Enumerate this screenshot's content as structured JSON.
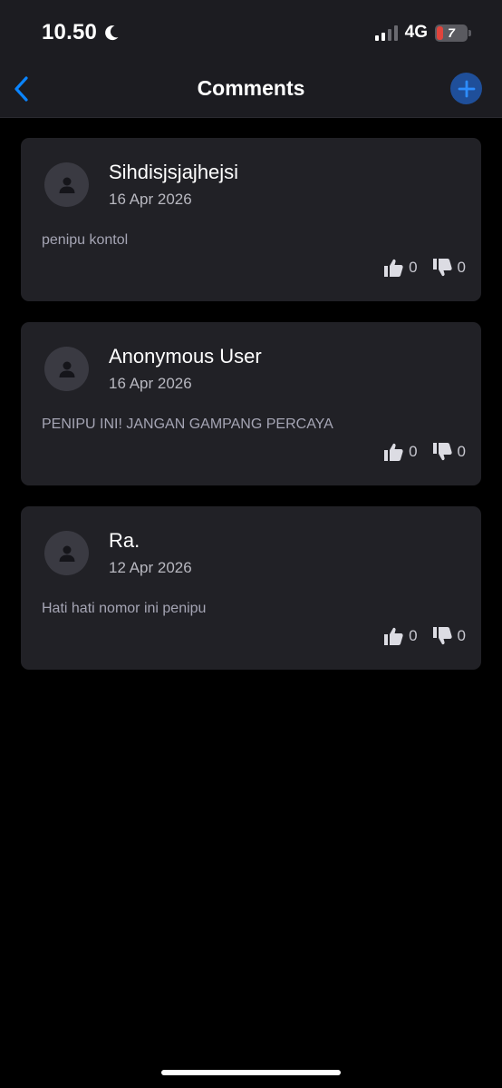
{
  "status_bar": {
    "time": "10.50",
    "network": "4G",
    "battery": "7"
  },
  "header": {
    "title": "Comments"
  },
  "comments": [
    {
      "author": "Sihdisjsjajhejsi",
      "date": "16 Apr 2026",
      "text": "penipu kontol",
      "likes": "0",
      "dislikes": "0"
    },
    {
      "author": "Anonymous User",
      "date": "16 Apr 2026",
      "text": "PENIPU INI! JANGAN GAMPANG PERCAYA",
      "likes": "0",
      "dislikes": "0"
    },
    {
      "author": "Ra.",
      "date": "12 Apr 2026",
      "text": "Hati hati nomor ini penipu",
      "likes": "0",
      "dislikes": "0"
    }
  ],
  "colors": {
    "accent": "#0a84ff",
    "card": "#212126",
    "header": "#1c1c21"
  },
  "icons": {
    "back": "chevron-left-icon",
    "add": "plus-icon",
    "avatar": "user-icon",
    "like": "thumbs-up-icon",
    "dislike": "thumbs-down-icon"
  }
}
